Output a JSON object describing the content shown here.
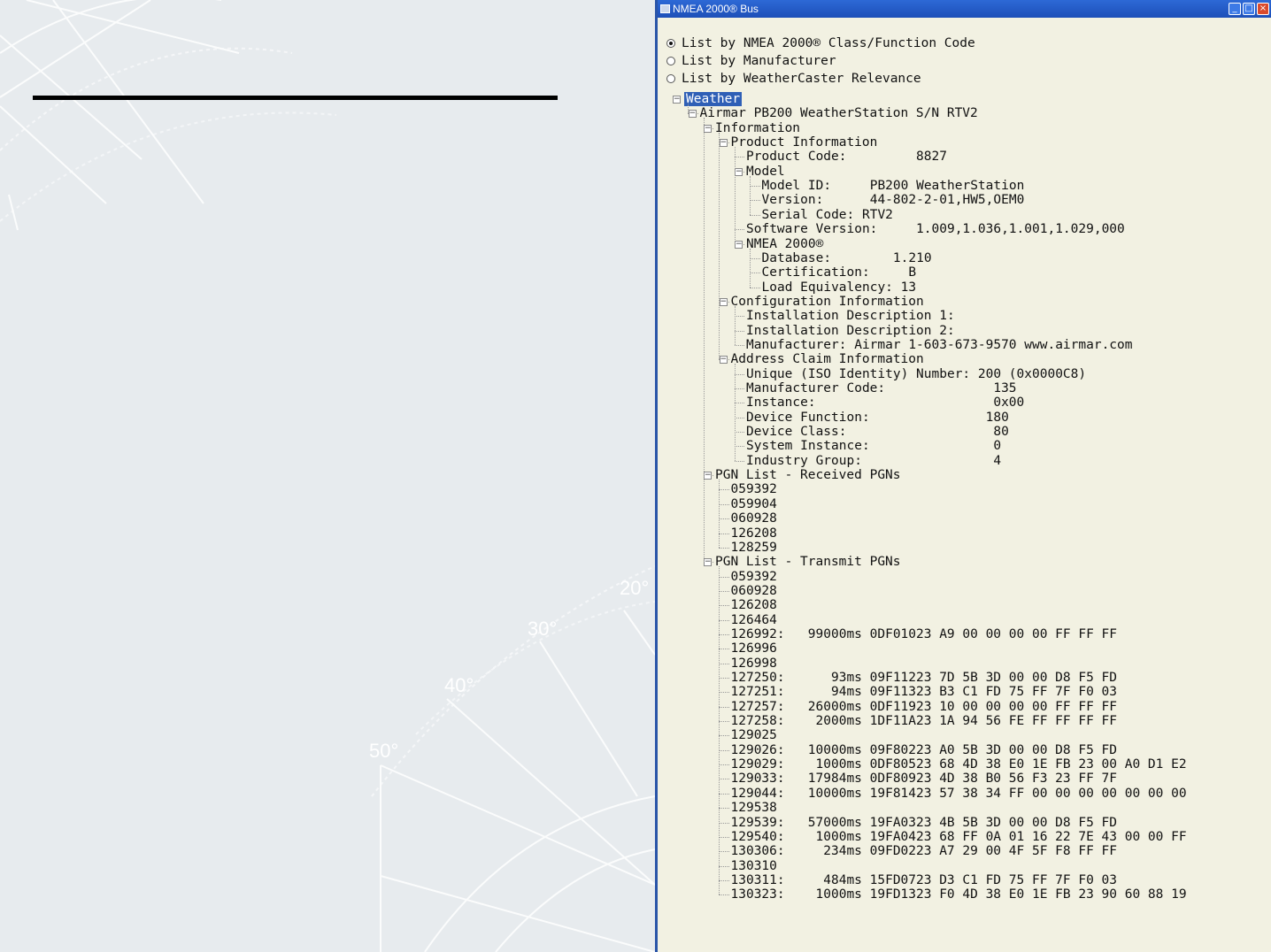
{
  "background": {
    "degree_labels": [
      "20°",
      "30°",
      "40°",
      "50°"
    ]
  },
  "window": {
    "title": "NMEA 2000® Bus",
    "radio_options": [
      {
        "label": "List by NMEA 2000® Class/Function Code",
        "selected": true
      },
      {
        "label": "List by Manufacturer",
        "selected": false
      },
      {
        "label": "List by WeatherCaster Relevance",
        "selected": false
      }
    ],
    "tree": [
      {
        "level": 0,
        "text": "Weather",
        "expander": "minus",
        "selected": true
      },
      {
        "level": 1,
        "text": "Airmar PB200 WeatherStation S/N RTV2",
        "expander": "minus"
      },
      {
        "level": 2,
        "text": "Information",
        "expander": "minus"
      },
      {
        "level": 3,
        "text": "Product Information",
        "expander": "minus"
      },
      {
        "level": 4,
        "text": "Product Code:         8827"
      },
      {
        "level": 4,
        "text": "Model",
        "expander": "minus"
      },
      {
        "level": 5,
        "text": "Model ID:     PB200 WeatherStation"
      },
      {
        "level": 5,
        "text": "Version:      44-802-2-01,HW5,OEM0"
      },
      {
        "level": 5,
        "text": "Serial Code: RTV2"
      },
      {
        "level": 4,
        "text": "Software Version:     1.009,1.036,1.001,1.029,000"
      },
      {
        "level": 4,
        "text": "NMEA 2000®",
        "expander": "minus"
      },
      {
        "level": 5,
        "text": "Database:        1.210"
      },
      {
        "level": 5,
        "text": "Certification:     B"
      },
      {
        "level": 5,
        "text": "Load Equivalency: 13"
      },
      {
        "level": 3,
        "text": "Configuration Information",
        "expander": "minus"
      },
      {
        "level": 4,
        "text": "Installation Description 1:"
      },
      {
        "level": 4,
        "text": "Installation Description 2:"
      },
      {
        "level": 4,
        "text": "Manufacturer: Airmar 1-603-673-9570 www.airmar.com"
      },
      {
        "level": 3,
        "text": "Address Claim Information",
        "expander": "minus"
      },
      {
        "level": 4,
        "text": "Unique (ISO Identity) Number: 200 (0x0000C8)"
      },
      {
        "level": 4,
        "text": "Manufacturer Code:              135"
      },
      {
        "level": 4,
        "text": "Instance:                       0x00"
      },
      {
        "level": 4,
        "text": "Device Function:               180"
      },
      {
        "level": 4,
        "text": "Device Class:                   80"
      },
      {
        "level": 4,
        "text": "System Instance:                0"
      },
      {
        "level": 4,
        "text": "Industry Group:                 4"
      },
      {
        "level": 2,
        "text": "PGN List - Received PGNs",
        "expander": "minus"
      },
      {
        "level": 3,
        "text": "059392"
      },
      {
        "level": 3,
        "text": "059904"
      },
      {
        "level": 3,
        "text": "060928"
      },
      {
        "level": 3,
        "text": "126208"
      },
      {
        "level": 3,
        "text": "128259"
      },
      {
        "level": 2,
        "text": "PGN List - Transmit PGNs",
        "expander": "minus"
      },
      {
        "level": 3,
        "text": "059392"
      },
      {
        "level": 3,
        "text": "060928"
      },
      {
        "level": 3,
        "text": "126208"
      },
      {
        "level": 3,
        "text": "126464"
      },
      {
        "level": 3,
        "text": "126992:   99000ms 0DF01023 A9 00 00 00 00 FF FF FF"
      },
      {
        "level": 3,
        "text": "126996"
      },
      {
        "level": 3,
        "text": "126998"
      },
      {
        "level": 3,
        "text": "127250:      93ms 09F11223 7D 5B 3D 00 00 D8 F5 FD"
      },
      {
        "level": 3,
        "text": "127251:      94ms 09F11323 B3 C1 FD 75 FF 7F F0 03"
      },
      {
        "level": 3,
        "text": "127257:   26000ms 0DF11923 10 00 00 00 00 FF FF FF"
      },
      {
        "level": 3,
        "text": "127258:    2000ms 1DF11A23 1A 94 56 FE FF FF FF FF"
      },
      {
        "level": 3,
        "text": "129025"
      },
      {
        "level": 3,
        "text": "129026:   10000ms 09F80223 A0 5B 3D 00 00 D8 F5 FD"
      },
      {
        "level": 3,
        "text": "129029:    1000ms 0DF80523 68 4D 38 E0 1E FB 23 00 A0 D1 E2"
      },
      {
        "level": 3,
        "text": "129033:   17984ms 0DF80923 4D 38 B0 56 F3 23 FF 7F"
      },
      {
        "level": 3,
        "text": "129044:   10000ms 19F81423 57 38 34 FF 00 00 00 00 00 00 00"
      },
      {
        "level": 3,
        "text": "129538"
      },
      {
        "level": 3,
        "text": "129539:   57000ms 19FA0323 4B 5B 3D 00 00 D8 F5 FD"
      },
      {
        "level": 3,
        "text": "129540:    1000ms 19FA0423 68 FF 0A 01 16 22 7E 43 00 00 FF"
      },
      {
        "level": 3,
        "text": "130306:     234ms 09FD0223 A7 29 00 4F 5F F8 FF FF"
      },
      {
        "level": 3,
        "text": "130310"
      },
      {
        "level": 3,
        "text": "130311:     484ms 15FD0723 D3 C1 FD 75 FF 7F F0 03"
      },
      {
        "level": 3,
        "text": "130323:    1000ms 19FD1323 F0 4D 38 E0 1E FB 23 90 60 88 19"
      }
    ]
  }
}
